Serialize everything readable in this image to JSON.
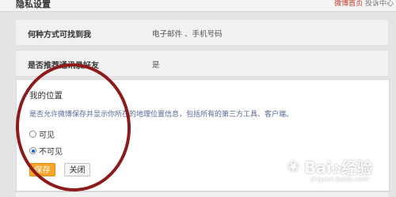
{
  "header": {
    "title": "隐私设置",
    "link_red": "微博首页",
    "link_gray": "投诉中心"
  },
  "contact_row": {
    "label": "何种方式可找到我",
    "value": "电子邮件 、手机号码"
  },
  "recommend_row": {
    "label": "是否推荐通讯录好友",
    "value": "是"
  },
  "location": {
    "title": "我的位置",
    "description": "是否允许微博保存并显示你所在的地理位置信息，包括所有的第三方工具、客户端。",
    "option_visible": "可见",
    "option_hidden": "不可见",
    "selected": "不可见",
    "save_label": "保存",
    "close_label": "关闭"
  },
  "watermark": {
    "brand": "Bai",
    "brand_end": "经验",
    "sub": "jingyan.baidu.com"
  },
  "colors": {
    "accent_orange": "#f7a52b",
    "annotation_red": "#8d1b1b",
    "link_red": "#c0392b",
    "radio_blue": "#1f5fd6"
  }
}
